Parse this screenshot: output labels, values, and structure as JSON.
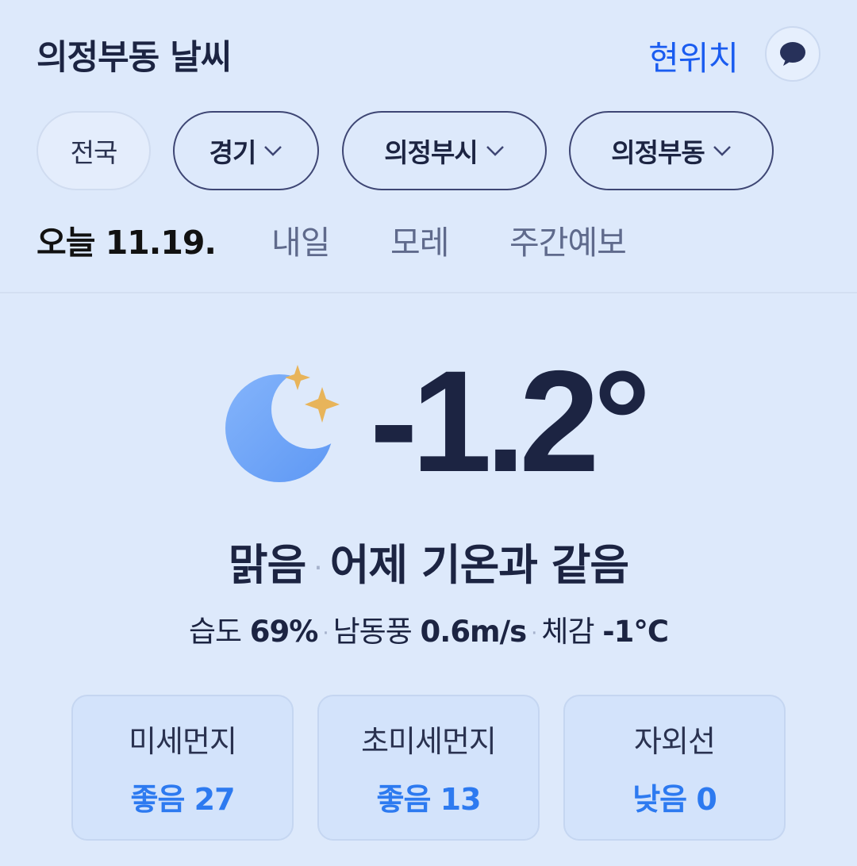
{
  "header": {
    "title": "의정부동 날씨",
    "location_link": "현위치"
  },
  "regions": [
    {
      "label": "전국",
      "has_dropdown": false
    },
    {
      "label": "경기",
      "has_dropdown": true
    },
    {
      "label": "의정부시",
      "has_dropdown": true
    },
    {
      "label": "의정부동",
      "has_dropdown": true
    }
  ],
  "tabs": {
    "today": "오늘 11.19.",
    "tomorrow": "내일",
    "day_after": "모레",
    "weekly": "주간예보"
  },
  "current": {
    "icon": "moon-stars-icon",
    "temperature": "-1.2°",
    "condition": "맑음",
    "comparison": "어제 기온과 같음",
    "humidity_label": "습도",
    "humidity_value": "69%",
    "wind_label": "남동풍",
    "wind_value": "0.6m/s",
    "feels_label": "체감",
    "feels_value": "-1°C"
  },
  "air": [
    {
      "label": "미세먼지",
      "value": "좋음 27"
    },
    {
      "label": "초미세먼지",
      "value": "좋음 13"
    },
    {
      "label": "자외선",
      "value": "낮음 0"
    }
  ],
  "colors": {
    "background": "#dde9fb",
    "accent": "#1a5cf0",
    "good": "#2d7af0",
    "moon": "#6aa3f8",
    "star": "#e8b45a"
  }
}
